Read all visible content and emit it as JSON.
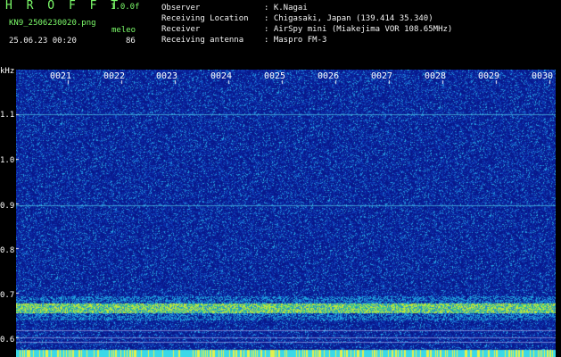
{
  "header": {
    "app_title": "H R O F F T",
    "version": "1.0.0f",
    "filename": "KN9_2506230020.png",
    "meleo_label": "meleo",
    "meleo_value": "86",
    "timestamp": "25.06.23 00:20"
  },
  "info": {
    "observer_label": "Observer",
    "observer_value": ": K.Nagai",
    "location_label": "Receiving Location",
    "location_value": ": Chigasaki, Japan (139.414 35.340)",
    "receiver_label": "Receiver",
    "receiver_value": ": AirSpy mini (Miakejima VOR 108.65MHz)",
    "antenna_label": "Receiving antenna",
    "antenna_value": ": Maspro FM-3"
  },
  "axis": {
    "unit": "kHz",
    "time_ticks": [
      "0021",
      "0022",
      "0023",
      "0024",
      "0025",
      "0026",
      "0027",
      "0028",
      "0029",
      "0030"
    ],
    "freq_ticks": [
      "1.1",
      "1.0",
      "0.9",
      "0.8",
      "0.7",
      "0.6"
    ]
  },
  "colors": {
    "header_green": "#7cfc6a",
    "background_blue": "#0a1c8c"
  }
}
